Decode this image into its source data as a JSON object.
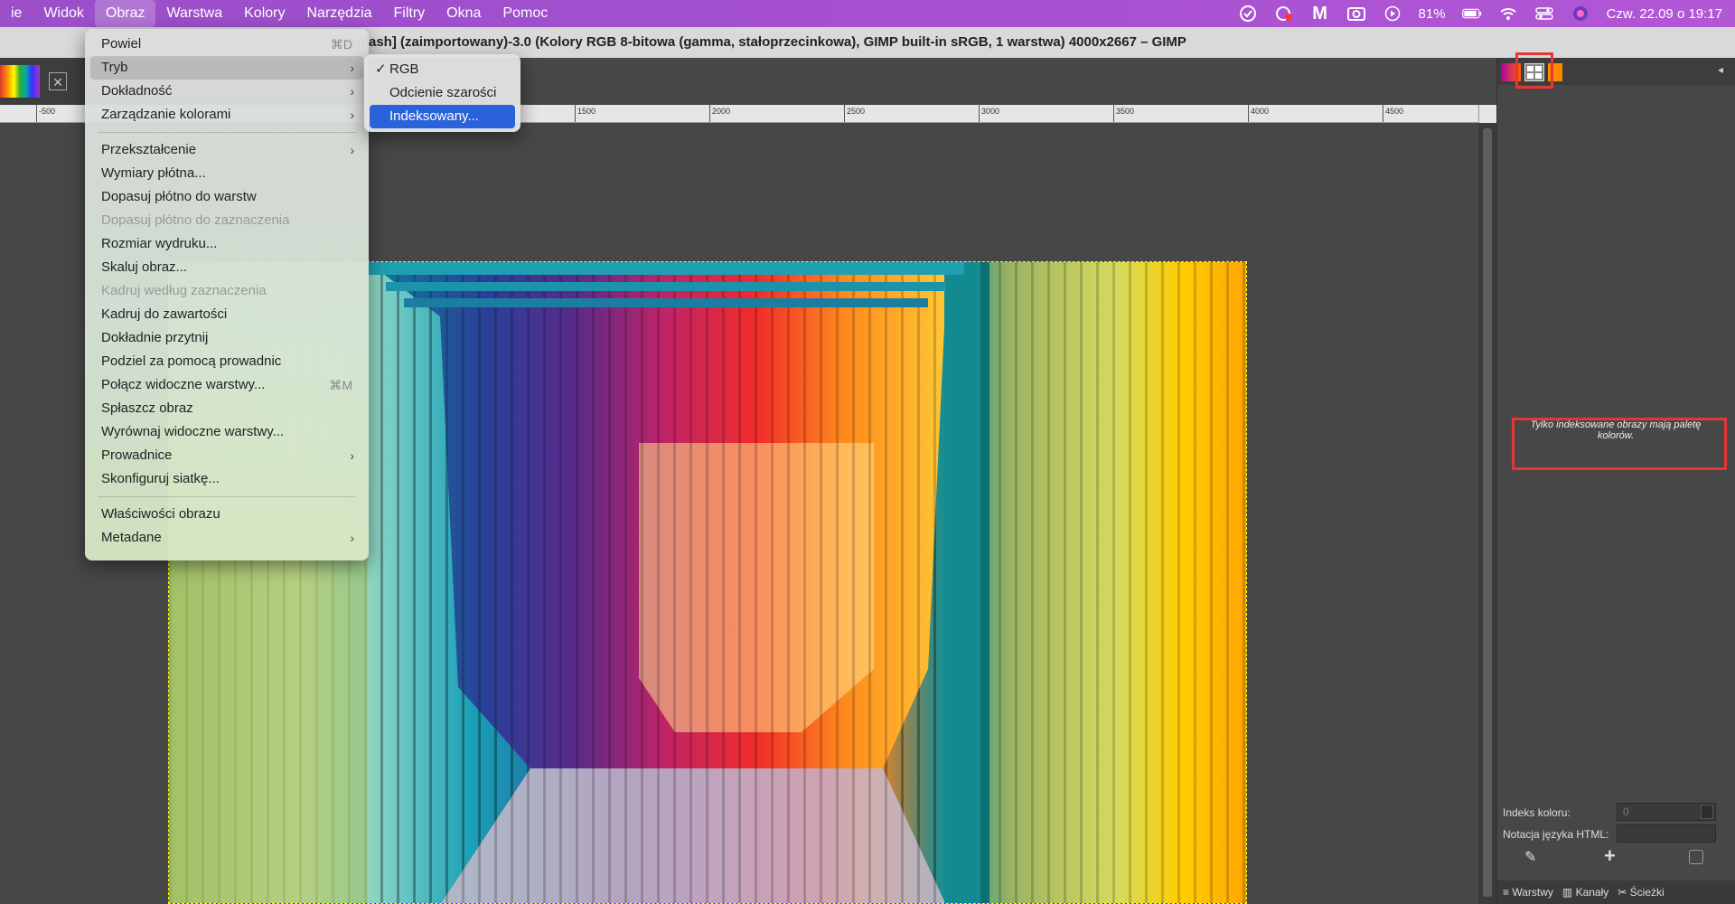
{
  "menubar": {
    "items": [
      "ie",
      "Widok",
      "Obraz",
      "Warstwa",
      "Kolory",
      "Narzędzia",
      "Filtry",
      "Okna",
      "Pomoc"
    ],
    "active_index": 2,
    "battery": "81%",
    "datetime": "Czw. 22.09 o  19:17"
  },
  "window": {
    "title": "unsplash] (zaimportowany)-3.0 (Kolory RGB 8-bitowa (gamma, stałoprzecinkowa), GIMP built-in sRGB, 1 warstwa) 4000x2667 – GIMP"
  },
  "ruler": {
    "labels": [
      "-500",
      "1500",
      "2000",
      "2500",
      "3000",
      "3500",
      "4000",
      "4500"
    ]
  },
  "image_menu": {
    "items": [
      {
        "label": "Powiel",
        "shortcut": "⌘D"
      },
      {
        "label": "Tryb",
        "submenu": true,
        "hover": true
      },
      {
        "label": "Dokładność",
        "submenu": true
      },
      {
        "label": "Zarządzanie kolorami",
        "submenu": true
      },
      {
        "separator": true
      },
      {
        "label": "Przekształcenie",
        "submenu": true
      },
      {
        "label": "Wymiary płótna..."
      },
      {
        "label": "Dopasuj płótno do warstw"
      },
      {
        "label": "Dopasuj płótno do zaznaczenia",
        "disabled": true
      },
      {
        "label": "Rozmiar wydruku..."
      },
      {
        "label": "Skaluj obraz..."
      },
      {
        "label": "Kadruj według zaznaczenia",
        "disabled": true
      },
      {
        "label": "Kadruj do zawartości"
      },
      {
        "label": "Dokładnie przytnij"
      },
      {
        "label": "Podziel za pomocą prowadnic"
      },
      {
        "label": "Połącz widoczne warstwy...",
        "shortcut": "⌘M"
      },
      {
        "label": "Spłaszcz obraz"
      },
      {
        "label": "Wyrównaj widoczne warstwy..."
      },
      {
        "label": "Prowadnice",
        "submenu": true
      },
      {
        "label": "Skonfiguruj siatkę..."
      },
      {
        "separator": true
      },
      {
        "label": "Właściwości obrazu"
      },
      {
        "label": "Metadane",
        "submenu": true
      }
    ]
  },
  "mode_submenu": {
    "items": [
      {
        "label": "RGB",
        "checked": true
      },
      {
        "label": "Odcienie szarości"
      },
      {
        "label": "Indeksowany...",
        "selected": true
      }
    ]
  },
  "dock": {
    "palette_message": "Tylko indeksowane obrazy mają paletę kolorów.",
    "color_index_label": "Indeks koloru:",
    "color_index_value": "0",
    "html_notation_label": "Notacja języka HTML:",
    "tabs": [
      "Warstwy",
      "Kanały",
      "Ścieżki"
    ]
  },
  "colors": {
    "menubar": "#a34fcf",
    "selection": "#2a63d9",
    "highlight": "#e53535",
    "canvas_bg": "#474747"
  }
}
